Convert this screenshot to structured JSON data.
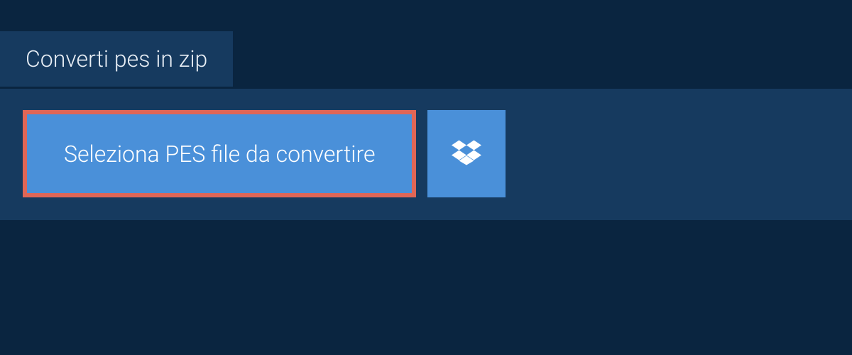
{
  "tab": {
    "label": "Converti pes in zip"
  },
  "actions": {
    "select_file_label": "Seleziona PES file da convertire"
  },
  "colors": {
    "background": "#0a2540",
    "panel": "#163a5f",
    "button": "#4a90d9",
    "highlight_border": "#e06656"
  }
}
